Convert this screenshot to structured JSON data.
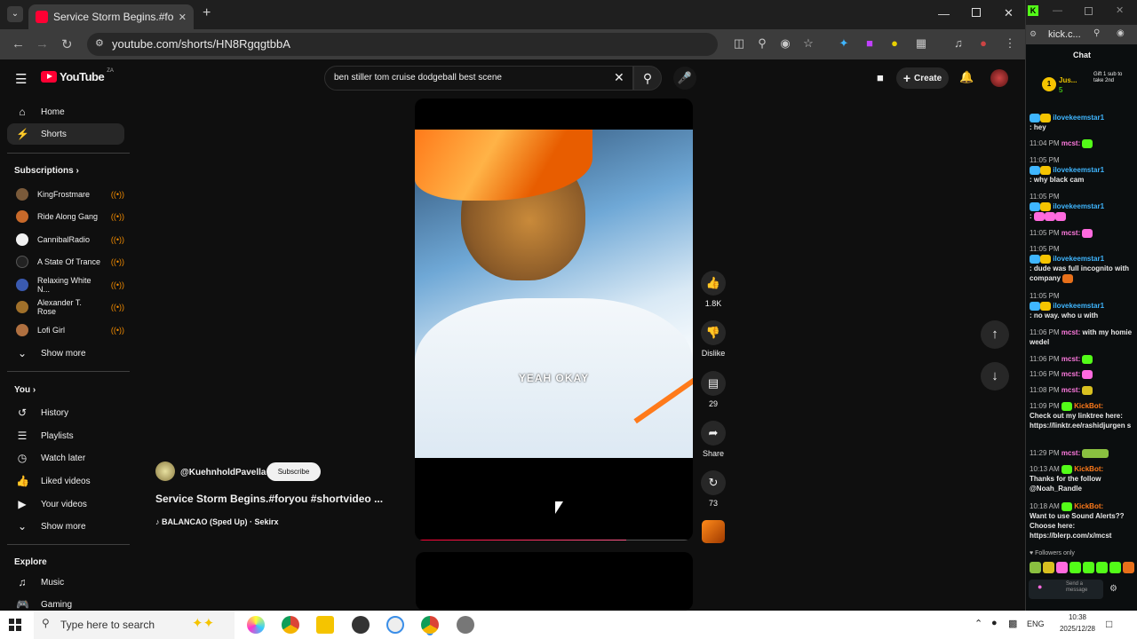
{
  "browser": {
    "tab_title": "Service Storm Begins.#foryo",
    "url": "youtube.com/shorts/HN8RgqgtbbA",
    "new_tab": "+",
    "kick_url": "kick.c..."
  },
  "youtube": {
    "logo": "YouTube",
    "logo_region": "ZA",
    "search_value": "ben stiller tom cruise dodgeball best scene",
    "create_label": "Create",
    "nav": [
      {
        "label": "Home",
        "icon": "home-icon"
      },
      {
        "label": "Shorts",
        "icon": "shorts-icon"
      }
    ],
    "subscriptions_heading": "Subscriptions",
    "subscriptions": [
      {
        "name": "KingFrostmare",
        "color": "#7a5a3a"
      },
      {
        "name": "Ride Along Gang",
        "color": "#c8692a"
      },
      {
        "name": "CannibalRadio",
        "color": "#f1f1f1"
      },
      {
        "name": "A State Of Trance",
        "color": "#222222"
      },
      {
        "name": "Relaxing White N...",
        "color": "#3a5ab0"
      },
      {
        "name": "Alexander T. Rose",
        "color": "#a0702a"
      },
      {
        "name": "Lofi Girl",
        "color": "#b07040"
      }
    ],
    "show_more": "Show more",
    "you_heading": "You",
    "you_items": [
      {
        "label": "History",
        "icon": "history-icon"
      },
      {
        "label": "Playlists",
        "icon": "playlists-icon"
      },
      {
        "label": "Watch later",
        "icon": "watch-later-icon"
      },
      {
        "label": "Liked videos",
        "icon": "like-icon"
      },
      {
        "label": "Your videos",
        "icon": "your-videos-icon"
      }
    ],
    "show_more_2": "Show more",
    "explore_heading": "Explore",
    "explore_items": [
      {
        "label": "Music",
        "icon": "music-icon"
      },
      {
        "label": "Gaming",
        "icon": "gaming-icon"
      }
    ],
    "short": {
      "channel": "@KuehnholdPavella",
      "subscribe": "Subscribe",
      "title": "Service Storm Begins.#foryou #shortvideo ...",
      "sound": "BALANCAO (Sped Up) · Sekirx",
      "caption": "YEAH OKAY",
      "progress": 0.77,
      "likes": "1.8K",
      "dislike": "Dislike",
      "comments": "29",
      "share": "Share",
      "remix": "73"
    }
  },
  "kick": {
    "chat_title": "Chat",
    "pinned_user": "Jus...",
    "pinned_count": "5",
    "gift_text": "Gift 1 sub to take 2nd",
    "messages": [
      {
        "ts": "",
        "user": "ilovekeemstar1",
        "text": ": hey"
      },
      {
        "ts": "11:04 PM",
        "user": "mcst:",
        "text": ""
      },
      {
        "ts": "11:05 PM",
        "user": "ilovekeemstar1",
        "text": ": why black cam"
      },
      {
        "ts": "11:05 PM",
        "user": "ilovekeemstar1",
        "text": ":"
      },
      {
        "ts": "11:05 PM",
        "user": "mcst:",
        "text": ""
      },
      {
        "ts": "11:05 PM",
        "user": "ilovekeemstar1",
        "text": ": dude was full incognito with company"
      },
      {
        "ts": "11:05 PM",
        "user": "ilovekeemstar1",
        "text": ": no way. who u with"
      },
      {
        "ts": "11:06 PM",
        "user": "mcst:",
        "text": "with my homie wedel"
      },
      {
        "ts": "11:06 PM",
        "user": "mcst:",
        "text": ""
      },
      {
        "ts": "11:06 PM",
        "user": "mcst:",
        "text": ""
      },
      {
        "ts": "11:08 PM",
        "user": "mcst:",
        "text": ""
      },
      {
        "ts": "11:09 PM",
        "user": "KickBot:",
        "text": "Check out my linktree here: https://linktr.ee/rashidjurgen s"
      },
      {
        "ts": "11:29 PM",
        "user": "mcst:",
        "text": ""
      },
      {
        "ts": "10:13 AM",
        "user": "KickBot:",
        "text": "Thanks for the follow @Noah_Randle"
      },
      {
        "ts": "10:18 AM",
        "user": "KickBot:",
        "text": "Want to use Sound Alerts?? Choose here: https://blerp.com/x/mcst"
      }
    ],
    "followers_only": "Followers only",
    "send_placeholder": "Send a message"
  },
  "taskbar": {
    "search_placeholder": "Type here to search",
    "lang": "ENG",
    "time": "10:38",
    "date": "2025/12/28"
  }
}
